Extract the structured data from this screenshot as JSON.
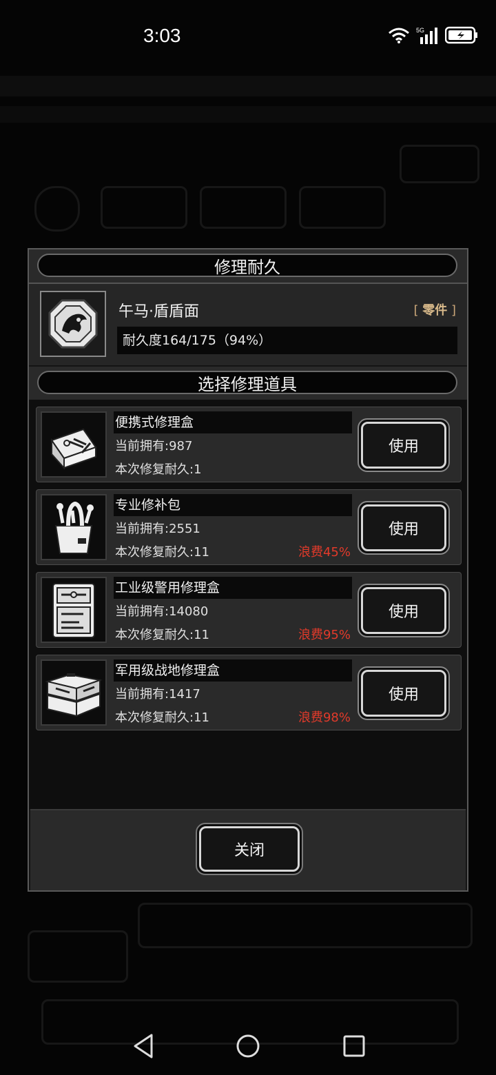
{
  "status_bar": {
    "time": "3:03",
    "network": "5G"
  },
  "dialog": {
    "title": "修理耐久",
    "item": {
      "name": "午马·盾盾面",
      "rarity_prefix": "[",
      "rarity": "零件",
      "rarity_suffix": "]",
      "durability_text": "耐久度164/175（94%）",
      "durability_fraction": 0.94,
      "icon": "shield-horse-icon"
    },
    "section_title": "选择修理道具",
    "tools": [
      {
        "name": "便携式修理盒",
        "owned": "当前拥有:987",
        "repair": "本次修复耐久:1",
        "waste": "",
        "use_label": "使用",
        "icon": "portable-repair-box-icon"
      },
      {
        "name": "专业修补包",
        "owned": "当前拥有:2551",
        "repair": "本次修复耐久:11",
        "waste": "浪费45%",
        "use_label": "使用",
        "icon": "repair-kit-bag-icon"
      },
      {
        "name": "工业级警用修理盒",
        "owned": "当前拥有:14080",
        "repair": "本次修复耐久:11",
        "waste": "浪费95%",
        "use_label": "使用",
        "icon": "industrial-repair-case-icon"
      },
      {
        "name": "军用级战地修理盒",
        "owned": "当前拥有:1417",
        "repair": "本次修复耐久:11",
        "waste": "浪费98%",
        "use_label": "使用",
        "icon": "military-toolbox-icon"
      }
    ],
    "close_label": "关闭"
  },
  "colors": {
    "waste": "#e23a2a",
    "rarity": "#c9a678",
    "panel": "#2a2a2a"
  }
}
